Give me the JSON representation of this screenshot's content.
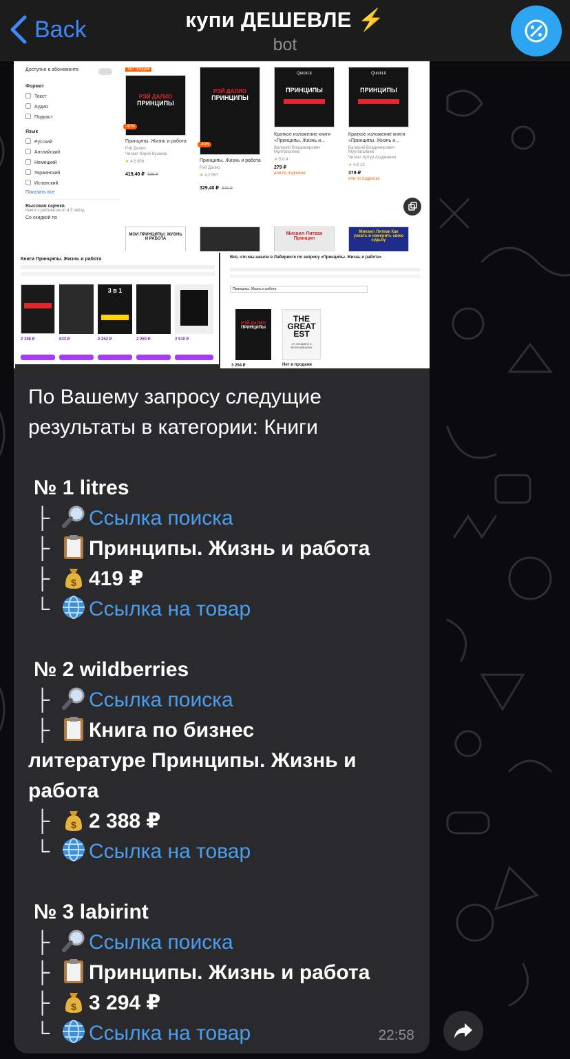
{
  "header": {
    "back_label": "Back",
    "title": "купи ДЕШЕВЛЕ ⚡️",
    "subtitle": "bot"
  },
  "colors": {
    "accent": "#3e88f7",
    "link": "#4a9ef0",
    "bubble": "#2a2a2d",
    "avatar": "#2da5f0"
  },
  "icons": {
    "search": "magnifier-icon",
    "title": "clipboard-icon",
    "price": "money-bag-icon",
    "product": "globe-icon",
    "share": "share-icon",
    "avatar": "percent-icon"
  },
  "screenshot_main": {
    "filters": {
      "available": "Доступно в абонементе",
      "format_heading": "Формат",
      "formats": [
        "Текст",
        "Аудио",
        "Подкаст"
      ],
      "lang_heading": "Язык",
      "languages": [
        "Русский",
        "Английский",
        "Немецкий",
        "Украинский",
        "Испанский"
      ],
      "show_all": "Показать все",
      "high_rating": "Высокая оценка",
      "high_rating_sub": "Книги с рейтингом от 4.5 звёзд",
      "discount": "Со скидкой по"
    },
    "books": [
      {
        "badge": "Хит продаж",
        "cover_author": "РЭЙ ДАЛИО",
        "cover_title": "ПРИНЦИПЫ",
        "discount": "-40%",
        "title": "Принципы. Жизнь и работа",
        "author": "Рэй Далио",
        "reader": "Читает Юрий Кузаков",
        "rating": "4,6",
        "votes": "808",
        "price": "419,40 ₽",
        "old_price": "699 ₽"
      },
      {
        "badge": "",
        "cover_author": "РЭЙ ДАЛИО",
        "cover_title": "ПРИНЦИПЫ",
        "discount": "-40%",
        "title": "Принципы. Жизнь и работа",
        "author": "Рэй Далио",
        "reader": "",
        "rating": "4,2",
        "votes": "957",
        "price": "329,40 ₽",
        "old_price": "549 ₽"
      },
      {
        "badge": "",
        "cover_author": "QuickLit",
        "cover_title": "ПРИНЦИПЫ",
        "discount": "",
        "title": "Краткое изложение книги «Принципы. Жизнь и...",
        "author": "Валерий Владимирович Муллагалеев",
        "reader": "",
        "rating": "5,0",
        "votes": "4",
        "price": "279 ₽",
        "old_price": "или по подписке"
      },
      {
        "badge": "",
        "cover_author": "QuickLit",
        "cover_title": "ПРИНЦИПЫ",
        "discount": "",
        "title": "Краткое изложение книги «Принципы. Жизнь и...",
        "author": "Валерий Владимирович Муллагалеев",
        "reader": "Читает Артур Агаджанян",
        "rating": "4,8",
        "votes": "13",
        "price": "379 ₽",
        "old_price": "или по подписке"
      }
    ],
    "bottom_books": [
      "МОИ ПРИНЦИПЫ: ЖИЗНЬ И РАБОТА",
      "",
      "Михаил Литвак Принцип",
      "Михаил Литвак Как узнать и изменить свою судьбу"
    ]
  },
  "screenshot_left": {
    "heading": "Книги Принципы. Жизнь и работа",
    "prices": [
      "2 388 ₽",
      "833 ₽",
      "2 252 ₽",
      "2 260 ₽",
      "2 510 ₽"
    ],
    "cover_badge": "3 в 1"
  },
  "screenshot_right": {
    "heading": "Все, что мы нашли в Лабиринте по запросу «Принципы. Жизнь и работа»",
    "search_value": "Принципы. Жизнь и работа",
    "book2_title": "THE GREAT EST",
    "book2_sub": "ОТ ЛУЧШЕГО К ВЕЛИЧАЙШЕМУ",
    "price": "3 294 ₽",
    "out_of_stock": "Нет в продаже"
  },
  "message": {
    "intro": "По Вашему запросу следущие результаты в категории: Книги",
    "search_link_label": "Ссылка поиска",
    "product_link_label": "Ссылка на товар",
    "results": [
      {
        "heading": "№ 1 litres",
        "title": "Принципы. Жизнь и работа",
        "price": "419 ₽"
      },
      {
        "heading": "№ 2 wildberries",
        "title_first": "Книга по бизнес",
        "title_rest": "литературе Принципы. Жизнь и работа",
        "price": "2 388 ₽"
      },
      {
        "heading": "№ 3 labirint",
        "title": "Принципы. Жизнь и работа",
        "price": "3 294 ₽"
      }
    ],
    "time": "22:58"
  }
}
